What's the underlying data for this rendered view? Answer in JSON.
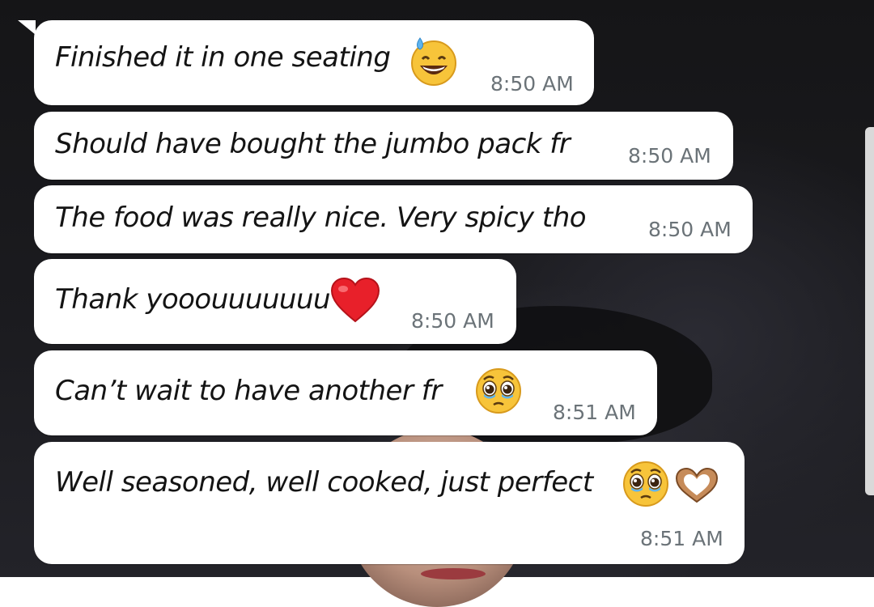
{
  "chat": {
    "messages": [
      {
        "text": "Finished it in one seating",
        "emoji": [
          "grinning-sweat-icon"
        ],
        "time": "8:50 AM"
      },
      {
        "text": "Should have bought the jumbo pack fr",
        "emoji": [],
        "time": "8:50 AM"
      },
      {
        "text": "The food was really nice. Very spicy tho",
        "emoji": [],
        "time": "8:50 AM"
      },
      {
        "text": "Thank yooouuuuuuu",
        "emoji": [
          "red-heart-icon"
        ],
        "time": "8:50 AM"
      },
      {
        "text": "Can’t wait to have another fr",
        "emoji": [
          "pleading-face-icon"
        ],
        "time": "8:51 AM"
      },
      {
        "text": "Well seasoned, well cooked, just perfect",
        "emoji": [
          "pleading-face-icon",
          "heart-hands-icon"
        ],
        "time": "8:51 AM"
      }
    ]
  },
  "colors": {
    "bubble": "#ffffff",
    "text": "#141414",
    "timestamp": "#6b7378",
    "background": "#1b1b1f",
    "heart": "#e8202a",
    "emoji_yellow": "#f7c43a",
    "heart_hands": "#c68b59"
  }
}
